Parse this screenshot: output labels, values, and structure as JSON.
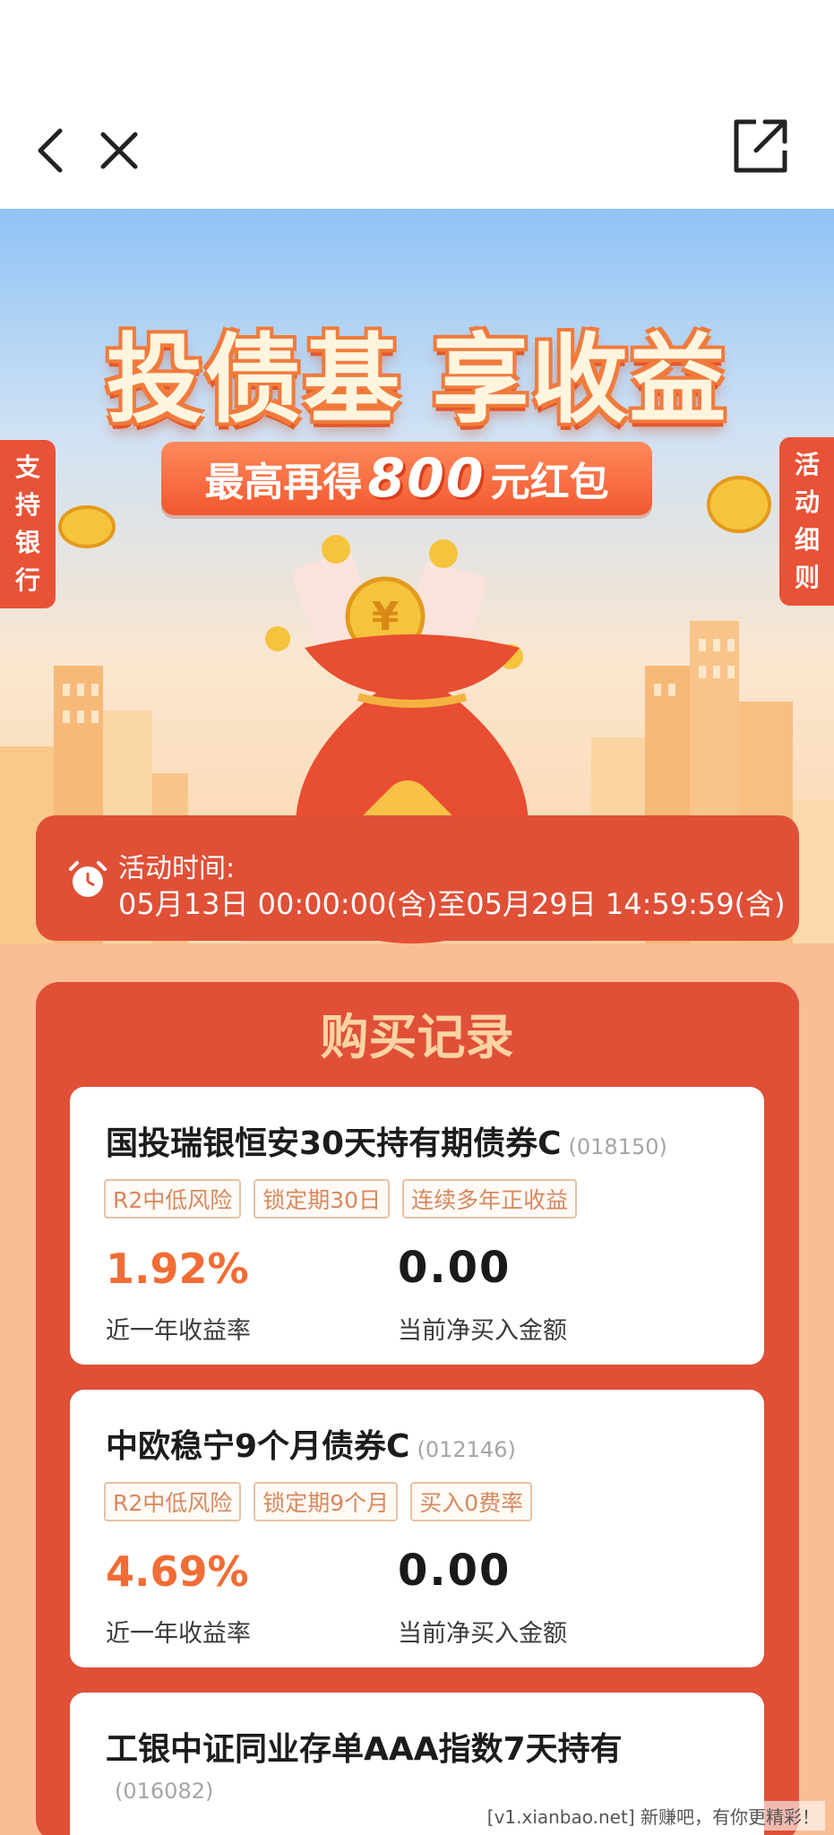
{
  "hero": {
    "title_left": "投债基",
    "title_right": "享收益",
    "subtitle_pre": "最高再得",
    "subtitle_amount": "800",
    "subtitle_post": "元红包",
    "side_left": [
      "支",
      "持",
      "银",
      "行"
    ],
    "side_right": [
      "活",
      "动",
      "细",
      "则"
    ]
  },
  "activity": {
    "label": "活动时间:",
    "range": "05月13日 00:00:00(含)至05月29日 14:59:59(含)"
  },
  "records": {
    "title": "购买记录",
    "funds": [
      {
        "name": "国投瑞银恒安30天持有期债券C",
        "code": "(018150)",
        "tags": [
          "R2中低风险",
          "锁定期30日",
          "连续多年正收益"
        ],
        "rate": "1.92%",
        "rate_label": "近一年收益率",
        "amount": "0.00",
        "amount_label": "当前净买入金额"
      },
      {
        "name": "中欧稳宁9个月债券C",
        "code": "(012146)",
        "tags": [
          "R2中低风险",
          "锁定期9个月",
          "买入0费率"
        ],
        "rate": "4.69%",
        "rate_label": "近一年收益率",
        "amount": "0.00",
        "amount_label": "当前净买入金额"
      },
      {
        "name": "工银中证同业存单AAA指数7天持有",
        "code": "(016082)"
      }
    ]
  },
  "watermark": "[v1.xianbao.net] 新赚吧，有你更精彩！",
  "colors": {
    "accent": "#df5037",
    "rate": "#f26c35",
    "tag_border": "#e8c2a3",
    "bg_lower": "#fbbd96"
  }
}
